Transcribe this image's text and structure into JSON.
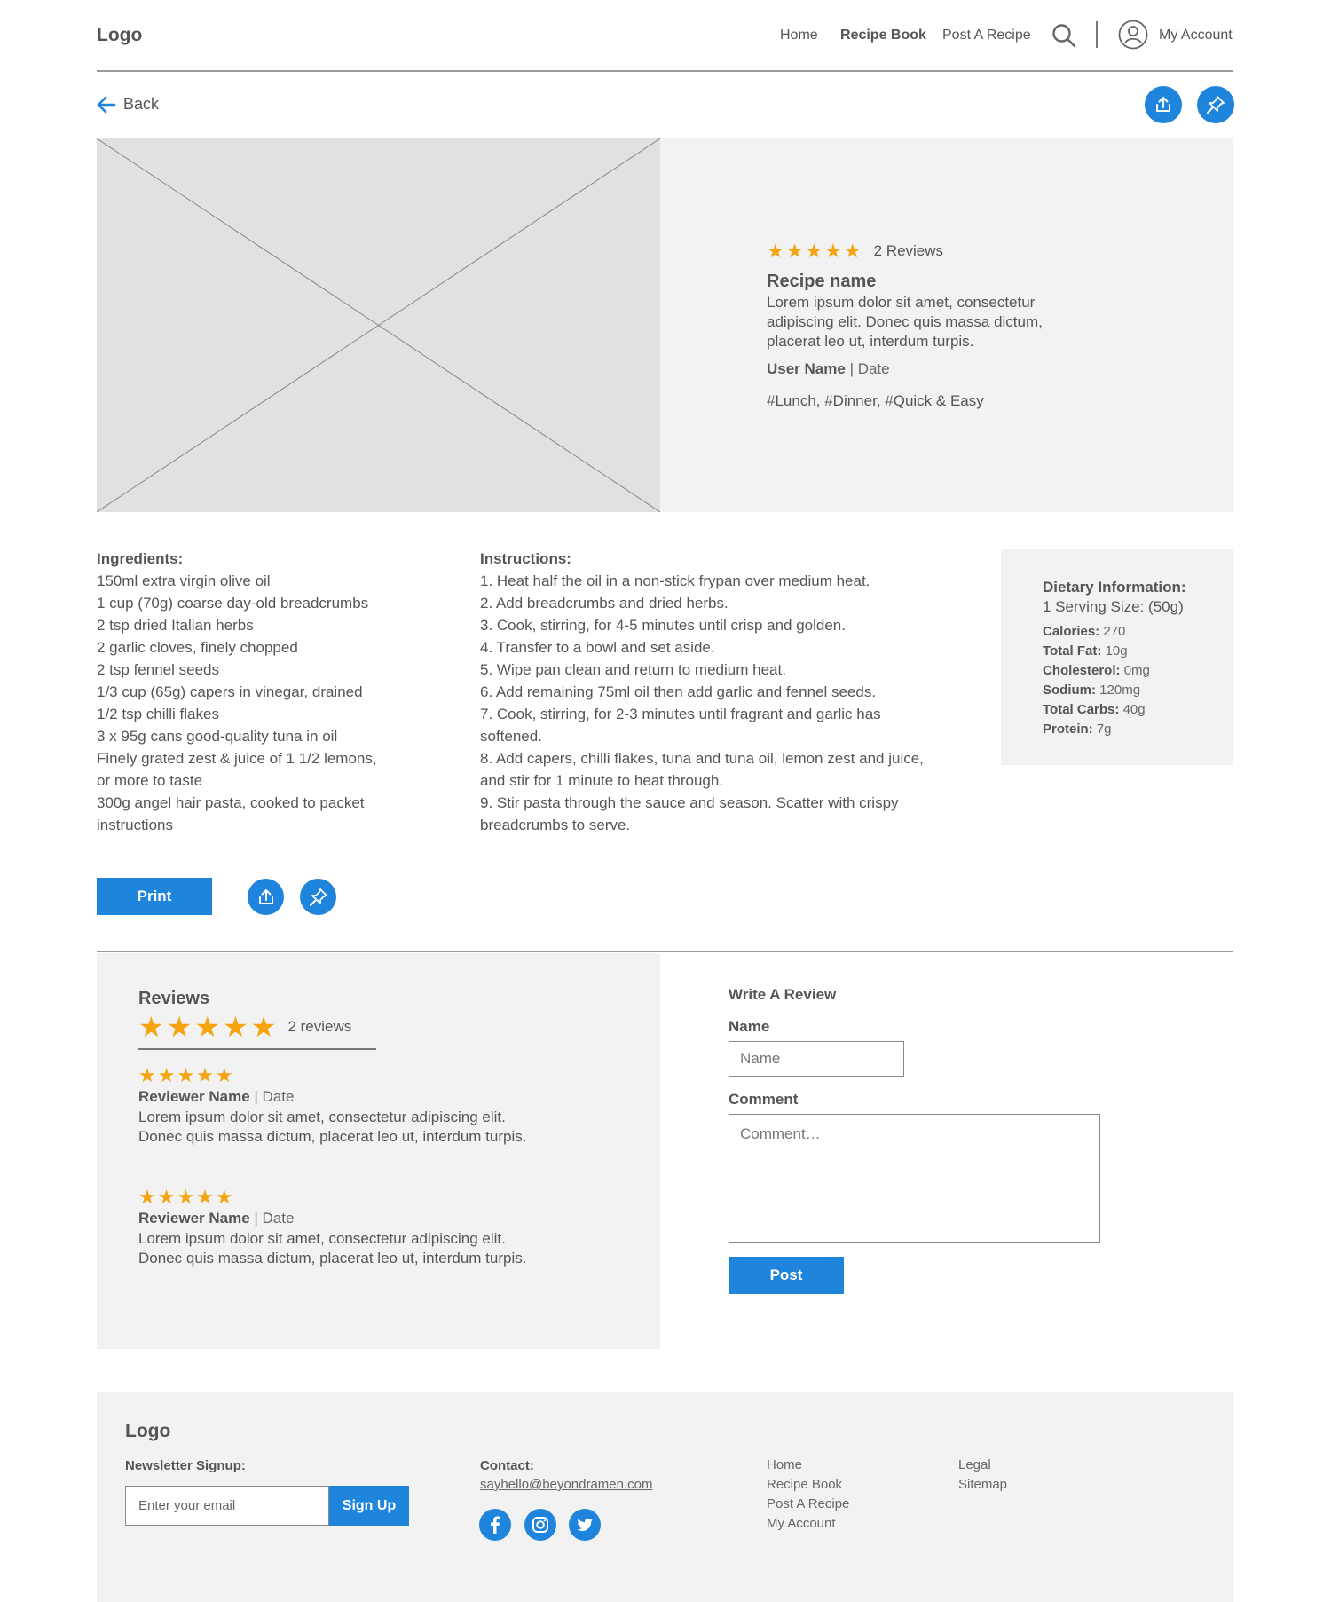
{
  "header": {
    "logo": "Logo",
    "nav": [
      "Home",
      "Recipe Book",
      "Post A Recipe"
    ],
    "account_label": "My Account"
  },
  "back_label": "Back",
  "hero": {
    "reviews_count": "2 Reviews",
    "recipe_name": "Recipe name",
    "description": "Lorem ipsum dolor sit amet, consectetur adipiscing elit. Donec quis massa dictum, placerat leo ut, interdum turpis.",
    "user_name": "User Name",
    "date": "| Date",
    "tags": "#Lunch, #Dinner, #Quick & Easy",
    "rating": 5
  },
  "ingredients": {
    "heading": "Ingredients:",
    "lines": [
      "150ml extra virgin olive oil",
      "1 cup (70g) coarse day-old breadcrumbs",
      "2 tsp dried Italian herbs",
      "2 garlic cloves, finely chopped",
      "2 tsp fennel seeds",
      "1/3 cup (65g) capers in vinegar, drained",
      "1/2 tsp chilli flakes",
      "3 x 95g cans good-quality tuna in oil",
      "Finely grated zest & juice of 1 1/2 lemons,",
      "or more to taste",
      "300g angel hair pasta, cooked to packet",
      "instructions"
    ]
  },
  "instructions": {
    "heading": "Instructions:",
    "lines": [
      "1. Heat half the oil in a non-stick frypan over medium heat.",
      "2. Add breadcrumbs and dried herbs.",
      "3. Cook, stirring, for 4-5 minutes until crisp and golden.",
      "4. Transfer to a bowl and set aside.",
      "5. Wipe pan clean and return to medium heat.",
      "6. Add remaining 75ml oil then add garlic and fennel seeds.",
      "7. Cook, stirring, for 2-3 minutes until fragrant and garlic has",
      "softened.",
      "8. Add capers, chilli flakes, tuna and tuna oil, lemon zest and juice,",
      "and stir for 1 minute to heat through.",
      "9. Stir pasta through the sauce and season. Scatter with crispy",
      "breadcrumbs to serve."
    ]
  },
  "dietary": {
    "heading": "Dietary Information:",
    "serving": "1 Serving Size: (50g)",
    "items": [
      {
        "label": "Calories:",
        "value": "270"
      },
      {
        "label": "Total Fat:",
        "value": "10g"
      },
      {
        "label": "Cholesterol:",
        "value": "0mg"
      },
      {
        "label": "Sodium:",
        "value": "120mg"
      },
      {
        "label": "Total Carbs:",
        "value": "40g"
      },
      {
        "label": "Protein:",
        "value": "7g"
      }
    ]
  },
  "print_label": "Print",
  "reviews": {
    "heading": "Reviews",
    "count": "2 reviews",
    "rating": 5,
    "items": [
      {
        "name": "Reviewer Name",
        "date": "| Date",
        "rating": 5,
        "text1": "Lorem ipsum dolor sit amet, consectetur adipiscing elit.",
        "text2": "Donec quis massa dictum, placerat leo ut, interdum turpis."
      },
      {
        "name": "Reviewer Name",
        "date": "| Date",
        "rating": 5,
        "text1": "Lorem ipsum dolor sit amet, consectetur adipiscing elit.",
        "text2": "Donec quis massa dictum, placerat leo ut, interdum turpis."
      }
    ]
  },
  "write_review": {
    "heading": "Write A Review",
    "name_label": "Name",
    "name_placeholder": "Name",
    "comment_label": "Comment",
    "comment_placeholder": "Comment…",
    "post_label": "Post"
  },
  "footer": {
    "logo": "Logo",
    "newsletter_label": "Newsletter Signup:",
    "email_placeholder": "Enter your email",
    "signup_label": "Sign Up",
    "contact_label": "Contact:",
    "email": "sayhello@beyondramen.com",
    "links_col1": [
      "Home",
      "Recipe Book",
      "Post A Recipe",
      "My Account"
    ],
    "links_col2": [
      "Legal",
      "Sitemap"
    ]
  },
  "colors": {
    "accent": "#1f84db",
    "star": "#f5a30f",
    "panel": "#f2f2f2"
  }
}
